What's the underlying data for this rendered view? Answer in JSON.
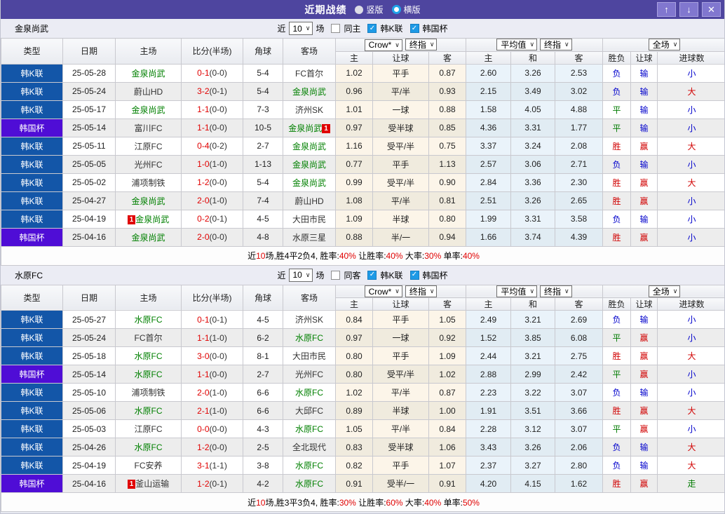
{
  "titlebar": {
    "title": "近期战绩",
    "vertical_label": "竖版",
    "horizontal_label": "横版"
  },
  "icons": {
    "up": "↑",
    "down": "↓",
    "close": "✕",
    "check": "✓",
    "dropdown": "∨"
  },
  "filter": {
    "near_label": "近",
    "games_label": "场",
    "league_label": "韩K联",
    "cup_label": "韩国杯"
  },
  "dropdowns": {
    "bookmaker": "Crow*",
    "final_index": "终指",
    "average": "平均值",
    "final_index2": "终指",
    "scope": "全场"
  },
  "columns": {
    "main": [
      "类型",
      "日期",
      "主场",
      "比分(半场)",
      "角球",
      "客场"
    ],
    "sub": [
      "主",
      "让球",
      "客",
      "主",
      "和",
      "客",
      "胜负",
      "让球",
      "进球数"
    ]
  },
  "colors": {
    "title_bg": "#4e459f",
    "k_league_bg": "#1356a8",
    "cup_bg": "#4f0dd6",
    "team_green": "#008000",
    "score_red": "#e00000"
  },
  "result_colors": {
    "胜": "#d10000",
    "平": "#007b00",
    "负": "#0000cc",
    "赢": "#d10000",
    "输": "#0000cc",
    "大": "#d10000",
    "小": "#0000cc",
    "走": "#007b00"
  },
  "sections": [
    {
      "team": "金泉尚武",
      "filter_count": "10",
      "same_label": "同主",
      "same_checked": false,
      "league_checked": true,
      "cup_checked": true,
      "rows": [
        {
          "league": "k",
          "type": "韩K联",
          "date": "25-05-28",
          "home": "金泉尚武",
          "home_green": true,
          "score": "0-1",
          "half": "(0-0)",
          "corner": "5-4",
          "away": "FC首尔",
          "away_green": false,
          "odds": [
            "1.02",
            "平手",
            "0.87"
          ],
          "avg": [
            "2.60",
            "3.26",
            "2.53"
          ],
          "results": [
            "负",
            "输",
            "小"
          ]
        },
        {
          "league": "k",
          "type": "韩K联",
          "date": "25-05-24",
          "home": "蔚山HD",
          "home_green": false,
          "score": "3-2",
          "half": "(0-1)",
          "corner": "5-4",
          "away": "金泉尚武",
          "away_green": true,
          "odds": [
            "0.96",
            "平/半",
            "0.93"
          ],
          "avg": [
            "2.15",
            "3.49",
            "3.02"
          ],
          "results": [
            "负",
            "输",
            "大"
          ]
        },
        {
          "league": "k",
          "type": "韩K联",
          "date": "25-05-17",
          "home": "金泉尚武",
          "home_green": true,
          "score": "1-1",
          "half": "(0-0)",
          "corner": "7-3",
          "away": "济州SK",
          "away_green": false,
          "odds": [
            "1.01",
            "一球",
            "0.88"
          ],
          "avg": [
            "1.58",
            "4.05",
            "4.88"
          ],
          "results": [
            "平",
            "输",
            "小"
          ]
        },
        {
          "league": "cup",
          "type": "韩国杯",
          "date": "25-05-14",
          "home": "富川FC",
          "home_green": false,
          "score": "1-1",
          "half": "(0-0)",
          "corner": "10-5",
          "away": "金泉尚武",
          "away_green": true,
          "away_badge": "1",
          "away_badge_side": "right",
          "odds": [
            "0.97",
            "受半球",
            "0.85"
          ],
          "avg": [
            "4.36",
            "3.31",
            "1.77"
          ],
          "results": [
            "平",
            "输",
            "小"
          ]
        },
        {
          "league": "k",
          "type": "韩K联",
          "date": "25-05-11",
          "home": "江原FC",
          "home_green": false,
          "score": "0-4",
          "half": "(0-2)",
          "corner": "2-7",
          "away": "金泉尚武",
          "away_green": true,
          "odds": [
            "1.16",
            "受平/半",
            "0.75"
          ],
          "avg": [
            "3.37",
            "3.24",
            "2.08"
          ],
          "results": [
            "胜",
            "赢",
            "大"
          ]
        },
        {
          "league": "k",
          "type": "韩K联",
          "date": "25-05-05",
          "home": "光州FC",
          "home_green": false,
          "score": "1-0",
          "half": "(1-0)",
          "corner": "1-13",
          "away": "金泉尚武",
          "away_green": true,
          "odds": [
            "0.77",
            "平手",
            "1.13"
          ],
          "avg": [
            "2.57",
            "3.06",
            "2.71"
          ],
          "results": [
            "负",
            "输",
            "小"
          ]
        },
        {
          "league": "k",
          "type": "韩K联",
          "date": "25-05-02",
          "home": "浦项制铁",
          "home_green": false,
          "score": "1-2",
          "half": "(0-0)",
          "corner": "5-4",
          "away": "金泉尚武",
          "away_green": true,
          "odds": [
            "0.99",
            "受平/半",
            "0.90"
          ],
          "avg": [
            "2.84",
            "3.36",
            "2.30"
          ],
          "results": [
            "胜",
            "赢",
            "大"
          ]
        },
        {
          "league": "k",
          "type": "韩K联",
          "date": "25-04-27",
          "home": "金泉尚武",
          "home_green": true,
          "score": "2-0",
          "half": "(1-0)",
          "corner": "7-4",
          "away": "蔚山HD",
          "away_green": false,
          "odds": [
            "1.08",
            "平/半",
            "0.81"
          ],
          "avg": [
            "2.51",
            "3.26",
            "2.65"
          ],
          "results": [
            "胜",
            "赢",
            "小"
          ]
        },
        {
          "league": "k",
          "type": "韩K联",
          "date": "25-04-19",
          "home": "金泉尚武",
          "home_green": true,
          "home_badge": "1",
          "home_badge_side": "left",
          "score": "0-2",
          "half": "(0-1)",
          "corner": "4-5",
          "away": "大田市民",
          "away_green": false,
          "odds": [
            "1.09",
            "半球",
            "0.80"
          ],
          "avg": [
            "1.99",
            "3.31",
            "3.58"
          ],
          "results": [
            "负",
            "输",
            "小"
          ]
        },
        {
          "league": "cup",
          "type": "韩国杯",
          "date": "25-04-16",
          "home": "金泉尚武",
          "home_green": true,
          "score": "2-0",
          "half": "(0-0)",
          "corner": "4-8",
          "away": "水原三星",
          "away_green": false,
          "odds": [
            "0.88",
            "半/一",
            "0.94"
          ],
          "avg": [
            "1.66",
            "3.74",
            "4.39"
          ],
          "results": [
            "胜",
            "赢",
            "小"
          ]
        }
      ],
      "summary": [
        {
          "t": "近"
        },
        {
          "t": "10",
          "red": true
        },
        {
          "t": "场,胜4平2负4, 胜率:"
        },
        {
          "t": "40%",
          "red": true
        },
        {
          "t": " 让胜率:"
        },
        {
          "t": "40%",
          "red": true
        },
        {
          "t": " 大率:"
        },
        {
          "t": "30%",
          "red": true
        },
        {
          "t": " 单率:"
        },
        {
          "t": "40%",
          "red": true
        }
      ]
    },
    {
      "team": "水原FC",
      "filter_count": "10",
      "same_label": "同客",
      "same_checked": false,
      "league_checked": true,
      "cup_checked": true,
      "rows": [
        {
          "league": "k",
          "type": "韩K联",
          "date": "25-05-27",
          "home": "水原FC",
          "home_green": true,
          "score": "0-1",
          "half": "(0-1)",
          "corner": "4-5",
          "away": "济州SK",
          "away_green": false,
          "odds": [
            "0.84",
            "平手",
            "1.05"
          ],
          "avg": [
            "2.49",
            "3.21",
            "2.69"
          ],
          "results": [
            "负",
            "输",
            "小"
          ]
        },
        {
          "league": "k",
          "type": "韩K联",
          "date": "25-05-24",
          "home": "FC首尔",
          "home_green": false,
          "score": "1-1",
          "half": "(1-0)",
          "corner": "6-2",
          "away": "水原FC",
          "away_green": true,
          "odds": [
            "0.97",
            "一球",
            "0.92"
          ],
          "avg": [
            "1.52",
            "3.85",
            "6.08"
          ],
          "results": [
            "平",
            "赢",
            "小"
          ]
        },
        {
          "league": "k",
          "type": "韩K联",
          "date": "25-05-18",
          "home": "水原FC",
          "home_green": true,
          "score": "3-0",
          "half": "(0-0)",
          "corner": "8-1",
          "away": "大田市民",
          "away_green": false,
          "odds": [
            "0.80",
            "平手",
            "1.09"
          ],
          "avg": [
            "2.44",
            "3.21",
            "2.75"
          ],
          "results": [
            "胜",
            "赢",
            "大"
          ]
        },
        {
          "league": "cup",
          "type": "韩国杯",
          "date": "25-05-14",
          "home": "水原FC",
          "home_green": true,
          "score": "1-1",
          "half": "(0-0)",
          "corner": "2-7",
          "away": "光州FC",
          "away_green": false,
          "odds": [
            "0.80",
            "受平/半",
            "1.02"
          ],
          "avg": [
            "2.88",
            "2.99",
            "2.42"
          ],
          "results": [
            "平",
            "赢",
            "小"
          ]
        },
        {
          "league": "k",
          "type": "韩K联",
          "date": "25-05-10",
          "home": "浦项制铁",
          "home_green": false,
          "score": "2-0",
          "half": "(1-0)",
          "corner": "6-6",
          "away": "水原FC",
          "away_green": true,
          "odds": [
            "1.02",
            "平/半",
            "0.87"
          ],
          "avg": [
            "2.23",
            "3.22",
            "3.07"
          ],
          "results": [
            "负",
            "输",
            "小"
          ]
        },
        {
          "league": "k",
          "type": "韩K联",
          "date": "25-05-06",
          "home": "水原FC",
          "home_green": true,
          "score": "2-1",
          "half": "(1-0)",
          "corner": "6-6",
          "away": "大邱FC",
          "away_green": false,
          "odds": [
            "0.89",
            "半球",
            "1.00"
          ],
          "avg": [
            "1.91",
            "3.51",
            "3.66"
          ],
          "results": [
            "胜",
            "赢",
            "大"
          ]
        },
        {
          "league": "k",
          "type": "韩K联",
          "date": "25-05-03",
          "home": "江原FC",
          "home_green": false,
          "score": "0-0",
          "half": "(0-0)",
          "corner": "4-3",
          "away": "水原FC",
          "away_green": true,
          "odds": [
            "1.05",
            "平/半",
            "0.84"
          ],
          "avg": [
            "2.28",
            "3.12",
            "3.07"
          ],
          "results": [
            "平",
            "赢",
            "小"
          ]
        },
        {
          "league": "k",
          "type": "韩K联",
          "date": "25-04-26",
          "home": "水原FC",
          "home_green": true,
          "score": "1-2",
          "half": "(0-0)",
          "corner": "2-5",
          "away": "全北现代",
          "away_green": false,
          "odds": [
            "0.83",
            "受半球",
            "1.06"
          ],
          "avg": [
            "3.43",
            "3.26",
            "2.06"
          ],
          "results": [
            "负",
            "输",
            "大"
          ]
        },
        {
          "league": "k",
          "type": "韩K联",
          "date": "25-04-19",
          "home": "FC安养",
          "home_green": false,
          "score": "3-1",
          "half": "(1-1)",
          "corner": "3-8",
          "away": "水原FC",
          "away_green": true,
          "odds": [
            "0.82",
            "平手",
            "1.07"
          ],
          "avg": [
            "2.37",
            "3.27",
            "2.80"
          ],
          "results": [
            "负",
            "输",
            "大"
          ]
        },
        {
          "league": "cup",
          "type": "韩国杯",
          "date": "25-04-16",
          "home": "釜山运输",
          "home_green": false,
          "home_badge": "1",
          "home_badge_side": "left",
          "score": "1-2",
          "half": "(0-1)",
          "corner": "4-2",
          "away": "水原FC",
          "away_green": true,
          "odds": [
            "0.91",
            "受半/一",
            "0.91"
          ],
          "avg": [
            "4.20",
            "4.15",
            "1.62"
          ],
          "results": [
            "胜",
            "赢",
            "走"
          ]
        }
      ],
      "summary": [
        {
          "t": "近"
        },
        {
          "t": "10",
          "red": true
        },
        {
          "t": "场,胜3平3负4, 胜率:"
        },
        {
          "t": "30%",
          "red": true
        },
        {
          "t": " 让胜率:"
        },
        {
          "t": "60%",
          "red": true
        },
        {
          "t": " 大率:"
        },
        {
          "t": "40%",
          "red": true
        },
        {
          "t": " 单率:"
        },
        {
          "t": "50%",
          "red": true
        }
      ]
    }
  ]
}
